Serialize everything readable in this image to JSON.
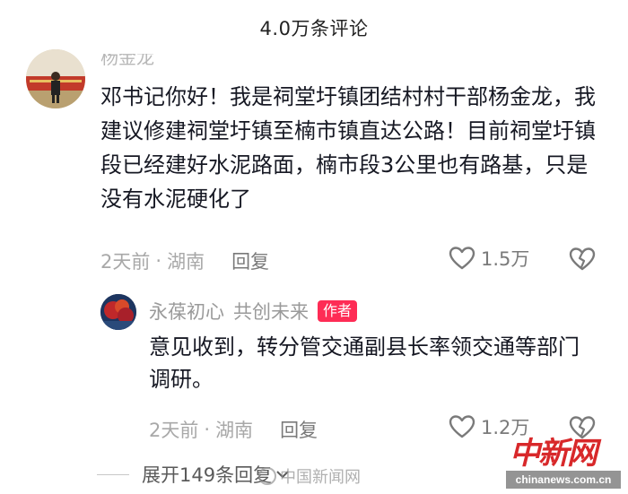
{
  "header": {
    "title": "4.0万条评论"
  },
  "comment": {
    "username_partial": "杨金龙",
    "text": "邓书记你好！我是祠堂圩镇团结村村干部杨金龙，我建议修建祠堂圩镇至楠市镇直达公路！目前祠堂圩镇段已经建好水泥路面，楠市段3公里也有路基，只是没有水泥硬化了",
    "time": "2天前",
    "dot": "·",
    "location": "湖南",
    "reply_label": "回复",
    "like_count": "1.5万"
  },
  "reply": {
    "username": "永葆初心",
    "tag": "共创未来",
    "author_badge": "作者",
    "text": "意见收到，转分管交通副县长率领交通等部门调研。",
    "time": "2天前",
    "dot": "·",
    "location": "湖南",
    "reply_label": "回复",
    "like_count": "1.2万"
  },
  "expand": {
    "label": "展开149条回复"
  },
  "watermark": {
    "logo": "中新网",
    "url": "chinanews.com.cn",
    "weibo": "中国新闻网"
  },
  "colors": {
    "accent": "#fe2c55",
    "text": "#161823",
    "meta": "#a8a8a8"
  }
}
